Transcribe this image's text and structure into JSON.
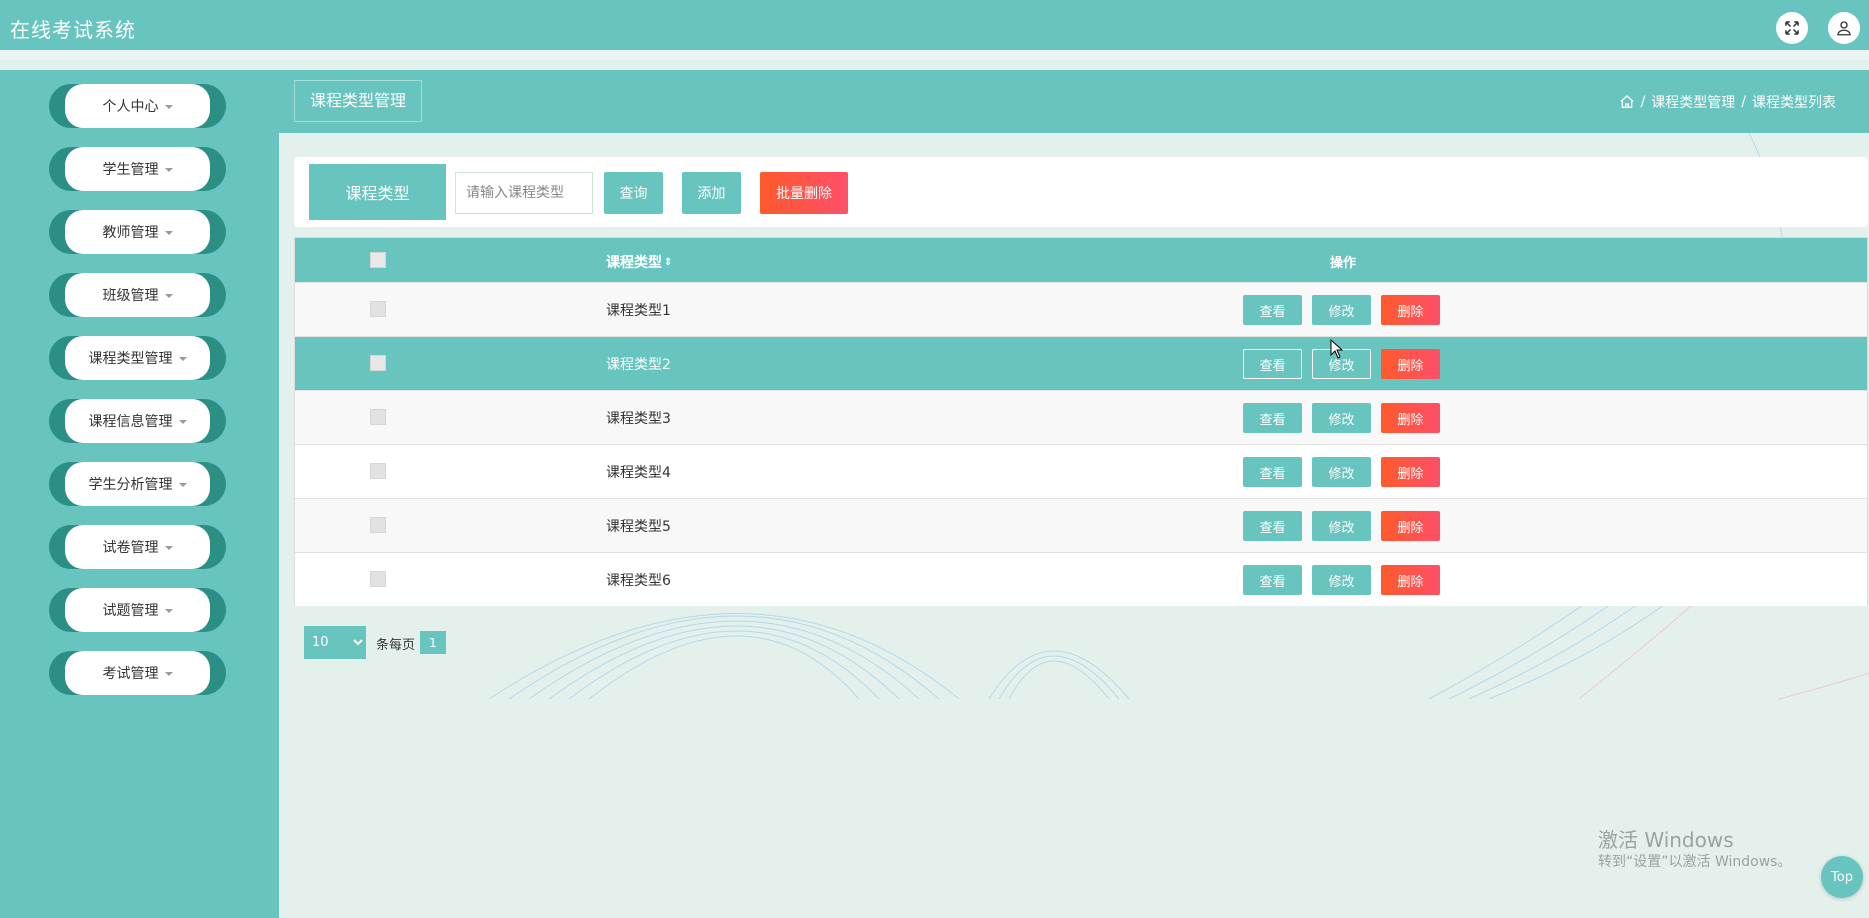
{
  "app": {
    "title": "在线考试系统"
  },
  "header_icons": [
    "fullscreen-icon",
    "user-icon"
  ],
  "sidebar": {
    "items": [
      {
        "label": "个人中心"
      },
      {
        "label": "学生管理"
      },
      {
        "label": "教师管理"
      },
      {
        "label": "班级管理"
      },
      {
        "label": "课程类型管理"
      },
      {
        "label": "课程信息管理"
      },
      {
        "label": "学生分析管理"
      },
      {
        "label": "试卷管理"
      },
      {
        "label": "试题管理"
      },
      {
        "label": "考试管理"
      }
    ]
  },
  "content_header": {
    "title": "课程类型管理",
    "breadcrumb": {
      "sep1": "/",
      "item1": "课程类型管理",
      "sep2": "/",
      "item2": "课程类型列表"
    }
  },
  "search": {
    "label": "课程类型",
    "placeholder": "请输入课程类型",
    "query_button": "查询",
    "add_button": "添加",
    "batch_delete_button": "批量删除"
  },
  "table": {
    "headers": {
      "type": "课程类型",
      "sort_icon": "⇕",
      "ops": "操作"
    },
    "actions": {
      "view": "查看",
      "edit": "修改",
      "delete": "删除"
    },
    "rows": [
      {
        "type": "课程类型1"
      },
      {
        "type": "课程类型2"
      },
      {
        "type": "课程类型3"
      },
      {
        "type": "课程类型4"
      },
      {
        "type": "课程类型5"
      },
      {
        "type": "课程类型6"
      }
    ]
  },
  "pagination": {
    "page_size": "10",
    "per_page_text": "条每页",
    "current_page": "1"
  },
  "watermark": {
    "line1": "激活 Windows",
    "line2": "转到“设置”以激活 Windows。"
  },
  "back_to_top": "Top",
  "colors": {
    "primary": "#67c4bf",
    "danger": "#ff5a2c",
    "sidebar_pill": "#2c8f86",
    "background": "#e4f0ec"
  }
}
